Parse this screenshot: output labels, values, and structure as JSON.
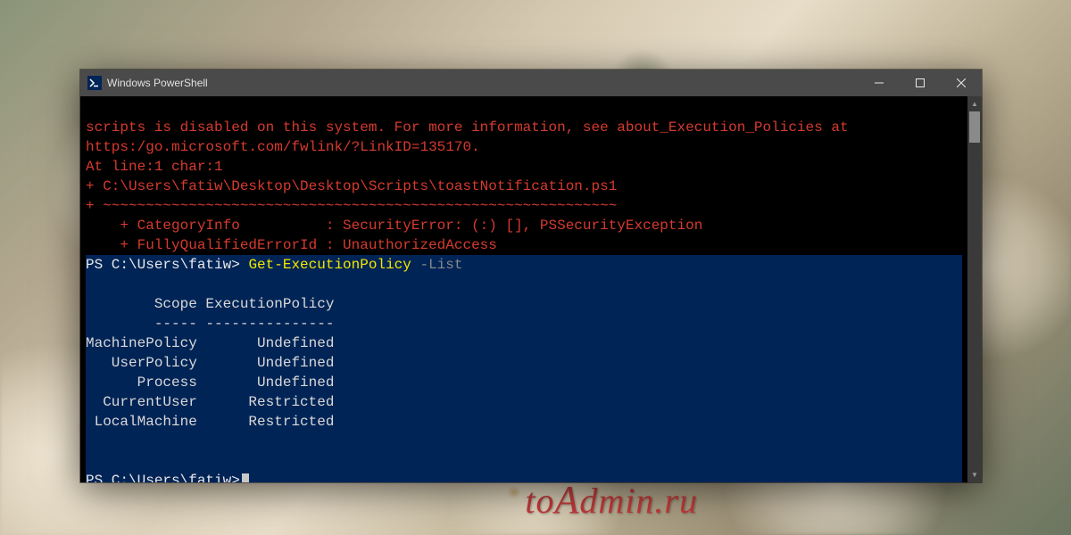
{
  "titlebar": {
    "title": "Windows PowerShell",
    "icon": "powershell-icon"
  },
  "terminal": {
    "error": {
      "line1": "scripts is disabled on this system. For more information, see about_Execution_Policies at",
      "line2": "https:/go.microsoft.com/fwlink/?LinkID=135170.",
      "line3": "At line:1 char:1",
      "line4": "+ C:\\Users\\fatiw\\Desktop\\Desktop\\Scripts\\toastNotification.ps1",
      "line5": "+ ~~~~~~~~~~~~~~~~~~~~~~~~~~~~~~~~~~~~~~~~~~~~~~~~~~~~~~~~~~~~",
      "line6": "    + CategoryInfo          : SecurityError: (:) [], PSSecurityException",
      "line7": "    + FullyQualifiedErrorId : UnauthorizedAccess"
    },
    "promptPath": "PS C:\\Users\\fatiw> ",
    "command": "Get-ExecutionPolicy",
    "param": " -List",
    "table": {
      "header": "        Scope ExecutionPolicy",
      "divider": "        ----- ---------------",
      "rows": [
        "MachinePolicy       Undefined",
        "   UserPolicy       Undefined",
        "      Process       Undefined",
        "  CurrentUser      Restricted",
        " LocalMachine      Restricted"
      ]
    },
    "prompt2": "PS C:\\Users\\fatiw>"
  },
  "watermark": {
    "text": "toAdmin.ru"
  }
}
